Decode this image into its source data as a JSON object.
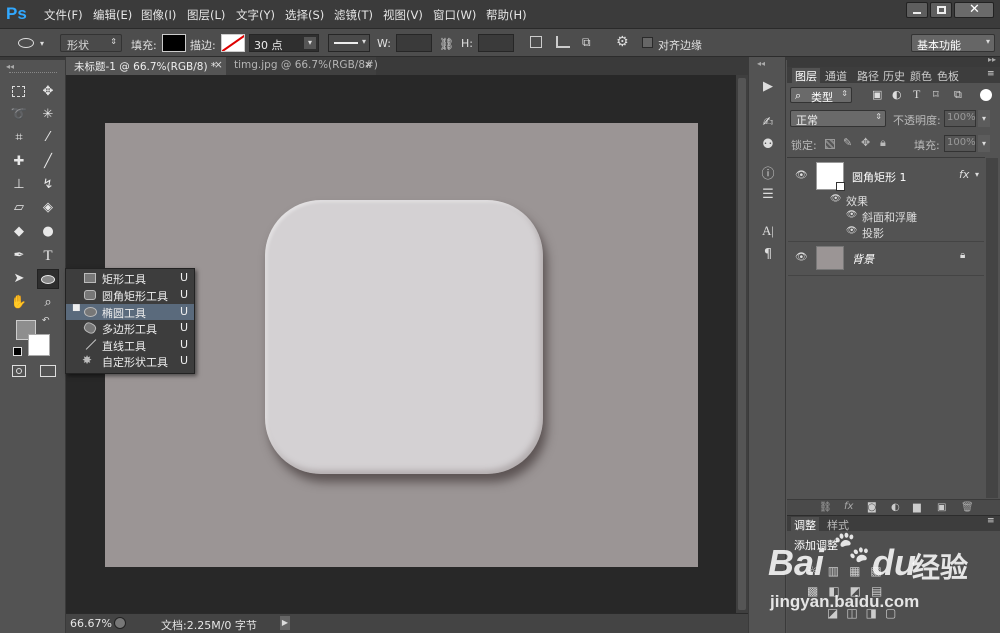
{
  "app": {
    "logo": "Ps"
  },
  "menu": [
    "文件(F)",
    "编辑(E)",
    "图像(I)",
    "图层(L)",
    "文字(Y)",
    "选择(S)",
    "滤镜(T)",
    "视图(V)",
    "窗口(W)",
    "帮助(H)"
  ],
  "options": {
    "mode": "形状",
    "fill_label": "填充:",
    "stroke_label": "描边:",
    "stroke_size": "30 点",
    "w_label": "W:",
    "h_label": "H:",
    "align_edges": "对齐边缘",
    "workspace": "基本功能"
  },
  "tabs": [
    {
      "label": "未标题-1 @ 66.7%(RGB/8) *",
      "close": "×"
    },
    {
      "label": "timg.jpg @ 66.7%(RGB/8#)",
      "close": "×"
    }
  ],
  "status": {
    "zoom": "66.67%",
    "doc": "文档:2.25M/0 字节"
  },
  "flyout": [
    {
      "label": "矩形工具",
      "key": "U",
      "active": false
    },
    {
      "label": "圆角矩形工具",
      "key": "U",
      "active": false
    },
    {
      "label": "椭圆工具",
      "key": "U",
      "active": true
    },
    {
      "label": "多边形工具",
      "key": "U",
      "active": false
    },
    {
      "label": "直线工具",
      "key": "U",
      "active": false
    },
    {
      "label": "自定形状工具",
      "key": "U",
      "active": false
    }
  ],
  "panel_tabs": [
    "图层",
    "通道",
    "路径",
    "历史",
    "颜色",
    "色板"
  ],
  "layers_panel": {
    "filter": "类型",
    "blend": "正常",
    "opacity_label": "不透明度:",
    "opacity": "100%",
    "lock_label": "锁定:",
    "fill_label": "填充:",
    "fill": "100%",
    "layers": [
      {
        "name": "圆角矩形 1",
        "fx": "fx",
        "effects_label": "效果",
        "effects": [
          "斜面和浮雕",
          "投影"
        ]
      },
      {
        "name": "背景"
      }
    ]
  },
  "adjust_panel": {
    "tabs": [
      "调整",
      "样式"
    ],
    "title": "添加调整"
  },
  "watermark": {
    "brand": "Bai",
    "brand2": "du",
    "jingyan": "经验",
    "url": "jingyan.baidu.com"
  },
  "colors": {
    "accent": "#31a8ff",
    "shape": "#d4d1d3",
    "document": "#9b9595",
    "canvas_bg": "#282828"
  }
}
